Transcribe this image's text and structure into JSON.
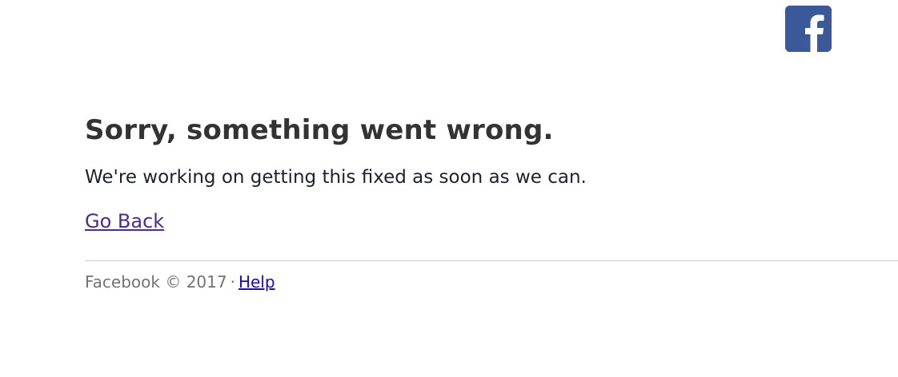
{
  "brand": {
    "logo_icon": "facebook-logo-icon",
    "brand_color": "#3b5998"
  },
  "error": {
    "title": "Sorry, something went wrong.",
    "message": "We're working on getting this fixed as soon as we can.",
    "go_back_label": "Go Back"
  },
  "footer": {
    "copyright": "Facebook © 2017",
    "separator": "·",
    "help_label": "Help"
  },
  "colors": {
    "visited_link": "#4b2e83",
    "link": "#1a0dab",
    "footer_text": "#737373",
    "divider": "#cccccc"
  }
}
